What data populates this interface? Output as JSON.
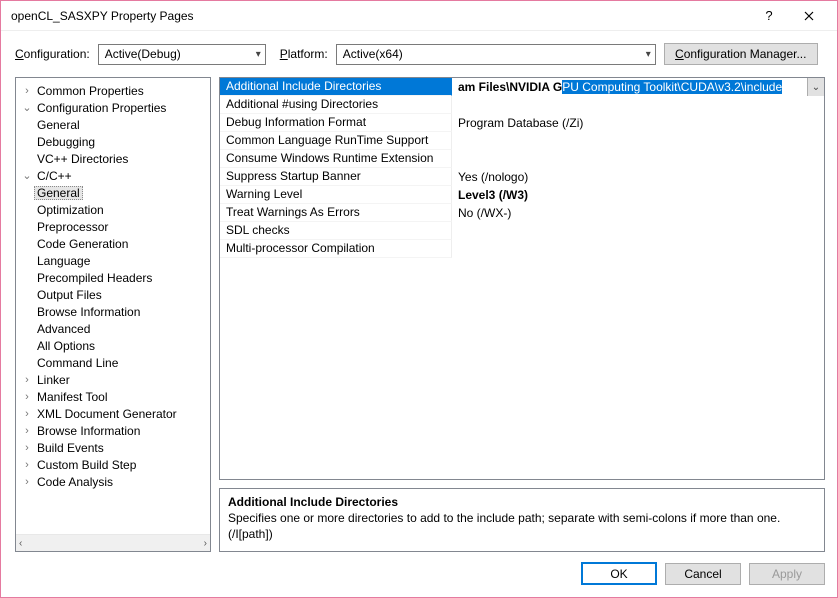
{
  "window": {
    "title": "openCL_SASXPY Property Pages"
  },
  "toolbar": {
    "config_label_pre": "C",
    "config_label_rest": "onfiguration:",
    "config_value": "Active(Debug)",
    "platform_label_pre": "P",
    "platform_label_rest": "latform:",
    "platform_value": "Active(x64)",
    "config_mgr_pre": "C",
    "config_mgr_rest": "onfiguration Manager..."
  },
  "tree": [
    {
      "level": 0,
      "exp": "›",
      "label": "Common Properties"
    },
    {
      "level": 0,
      "exp": "⌄",
      "label": "Configuration Properties"
    },
    {
      "level": 1,
      "exp": "",
      "label": "General"
    },
    {
      "level": 1,
      "exp": "",
      "label": "Debugging"
    },
    {
      "level": 1,
      "exp": "",
      "label": "VC++ Directories"
    },
    {
      "level": 1,
      "exp": "⌄",
      "label": "C/C++"
    },
    {
      "level": 2,
      "exp": "",
      "label": "General",
      "selected": true
    },
    {
      "level": 2,
      "exp": "",
      "label": "Optimization"
    },
    {
      "level": 2,
      "exp": "",
      "label": "Preprocessor"
    },
    {
      "level": 2,
      "exp": "",
      "label": "Code Generation"
    },
    {
      "level": 2,
      "exp": "",
      "label": "Language"
    },
    {
      "level": 2,
      "exp": "",
      "label": "Precompiled Headers"
    },
    {
      "level": 2,
      "exp": "",
      "label": "Output Files"
    },
    {
      "level": 2,
      "exp": "",
      "label": "Browse Information"
    },
    {
      "level": 2,
      "exp": "",
      "label": "Advanced"
    },
    {
      "level": 2,
      "exp": "",
      "label": "All Options"
    },
    {
      "level": 2,
      "exp": "",
      "label": "Command Line"
    },
    {
      "level": 1,
      "exp": "›",
      "label": "Linker"
    },
    {
      "level": 1,
      "exp": "›",
      "label": "Manifest Tool"
    },
    {
      "level": 1,
      "exp": "›",
      "label": "XML Document Generator"
    },
    {
      "level": 1,
      "exp": "›",
      "label": "Browse Information"
    },
    {
      "level": 1,
      "exp": "›",
      "label": "Build Events"
    },
    {
      "level": 1,
      "exp": "›",
      "label": "Custom Build Step"
    },
    {
      "level": 1,
      "exp": "›",
      "label": "Code Analysis"
    }
  ],
  "props": {
    "rows": [
      {
        "name": "Additional Include Directories",
        "value_prefix": "am Files\\NVIDIA G",
        "value_highlight": "PU Computing Toolkit\\CUDA\\v3.2\\include",
        "selected": true,
        "dropdown": true
      },
      {
        "name": "Additional #using Directories",
        "value": ""
      },
      {
        "name": "Debug Information Format",
        "value": "Program Database (/Zi)"
      },
      {
        "name": "Common Language RunTime Support",
        "value": ""
      },
      {
        "name": "Consume Windows Runtime Extension",
        "value": ""
      },
      {
        "name": "Suppress Startup Banner",
        "value": "Yes (/nologo)"
      },
      {
        "name": "Warning Level",
        "value": "Level3 (/W3)",
        "bold": true
      },
      {
        "name": "Treat Warnings As Errors",
        "value": "No (/WX-)"
      },
      {
        "name": "SDL checks",
        "value": ""
      },
      {
        "name": "Multi-processor Compilation",
        "value": ""
      }
    ],
    "desc_title": "Additional Include Directories",
    "desc_text": "Specifies one or more directories to add to the include path; separate with semi-colons if more than one. (/I[path])"
  },
  "footer": {
    "ok": "OK",
    "cancel": "Cancel",
    "apply_pre": "A",
    "apply_rest": "pply"
  }
}
